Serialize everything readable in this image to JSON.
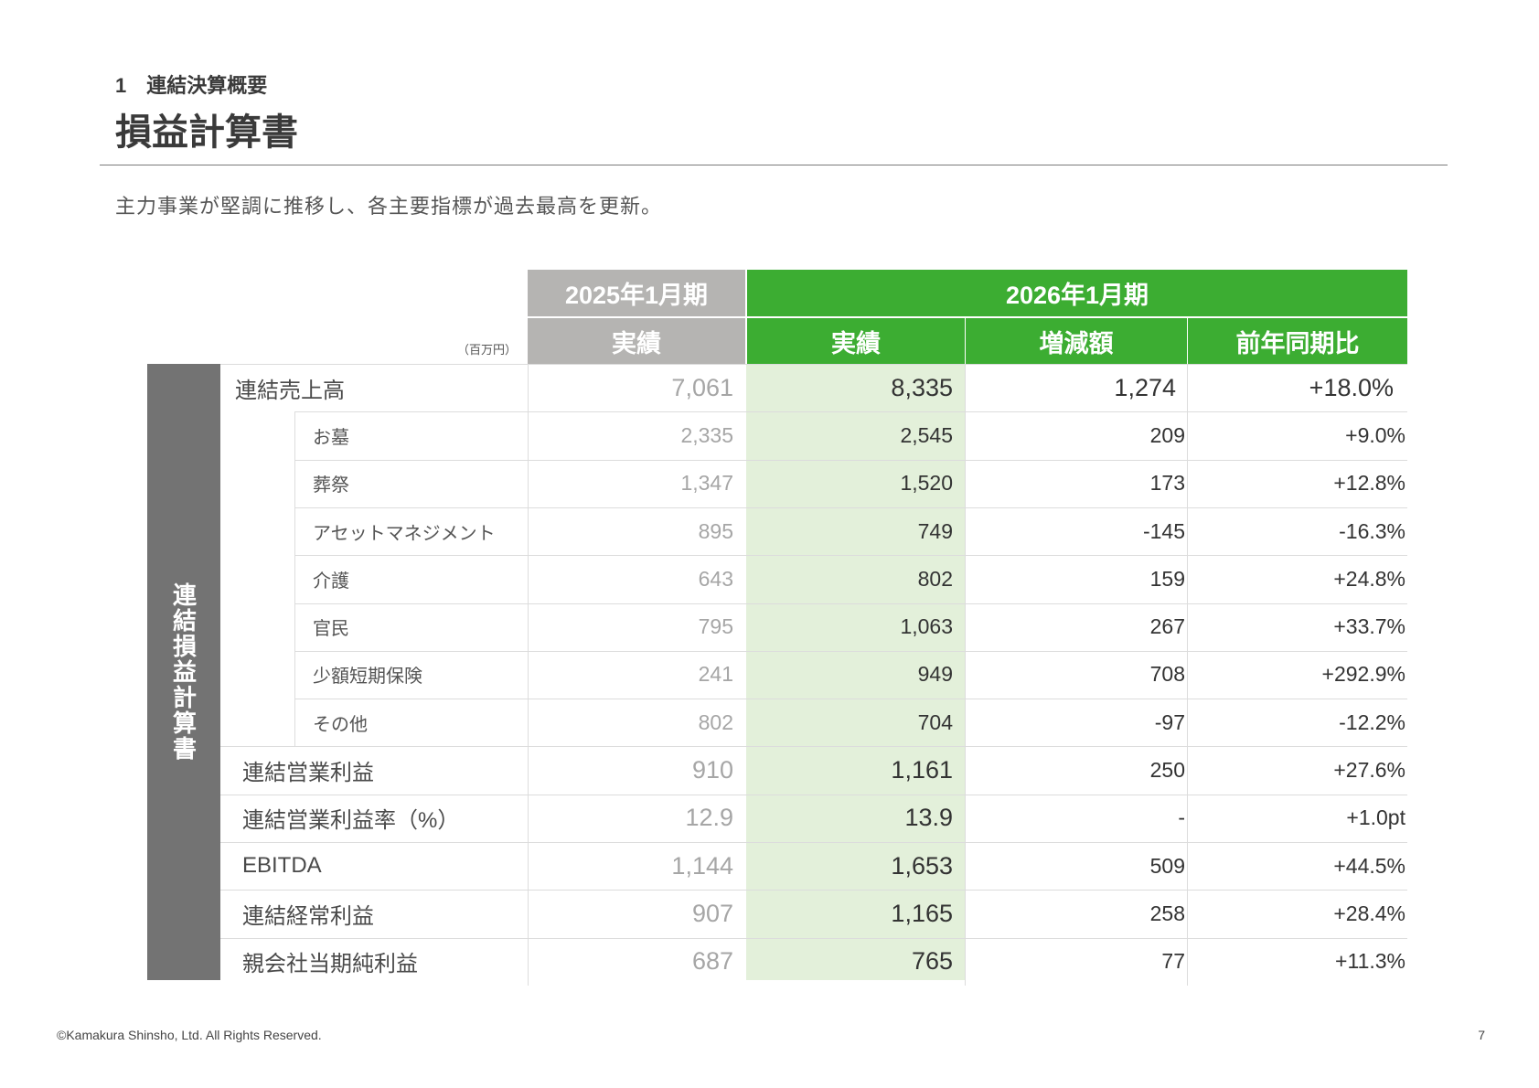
{
  "header": {
    "section_label": "1　連結決算概要",
    "page_title": "損益計算書",
    "subtitle": "主力事業が堅調に推移し、各主要指標が過去最高を更新。"
  },
  "table": {
    "unit_label": "（百万円）",
    "side_label": "連結損益計算書",
    "period_prev": "2025年1月期",
    "period_cur": "2026年1月期",
    "col_prev_actual": "実績",
    "col_cur_actual": "実績",
    "col_change": "増減額",
    "col_yoy": "前年同期比",
    "rows": [
      {
        "label": "連結売上高",
        "prev": "7,061",
        "cur": "8,335",
        "change": "1,274",
        "yoy": "+18.0%"
      },
      {
        "label": "お墓",
        "prev": "2,335",
        "cur": "2,545",
        "change": "209",
        "yoy": "+9.0%"
      },
      {
        "label": "葬祭",
        "prev": "1,347",
        "cur": "1,520",
        "change": "173",
        "yoy": "+12.8%"
      },
      {
        "label": "アセットマネジメント",
        "prev": "895",
        "cur": "749",
        "change": "-145",
        "yoy": "-16.3%"
      },
      {
        "label": "介護",
        "prev": "643",
        "cur": "802",
        "change": "159",
        "yoy": "+24.8%"
      },
      {
        "label": "官民",
        "prev": "795",
        "cur": "1,063",
        "change": "267",
        "yoy": "+33.7%"
      },
      {
        "label": "少額短期保険",
        "prev": "241",
        "cur": "949",
        "change": "708",
        "yoy": "+292.9%"
      },
      {
        "label": "その他",
        "prev": "802",
        "cur": "704",
        "change": "-97",
        "yoy": "-12.2%"
      },
      {
        "label": "連結営業利益",
        "prev": "910",
        "cur": "1,161",
        "change": "250",
        "yoy": "+27.6%"
      },
      {
        "label": "連結営業利益率（%）",
        "prev": "12.9",
        "cur": "13.9",
        "change": "-",
        "yoy": "+1.0pt"
      },
      {
        "label": "EBITDA",
        "prev": "1,144",
        "cur": "1,653",
        "change": "509",
        "yoy": "+44.5%"
      },
      {
        "label": "連結経常利益",
        "prev": "907",
        "cur": "1,165",
        "change": "258",
        "yoy": "+28.4%"
      },
      {
        "label": "親会社当期純利益",
        "prev": "687",
        "cur": "765",
        "change": "77",
        "yoy": "+11.3%"
      }
    ]
  },
  "colors": {
    "accent_green": "#3cad32",
    "header_gray": "#b5b4b2",
    "side_gray": "#737373",
    "current_shade": "#e3f0da"
  },
  "footer": {
    "copyright": "©Kamakura Shinsho, Ltd. All Rights Reserved.",
    "page_number": "7"
  }
}
